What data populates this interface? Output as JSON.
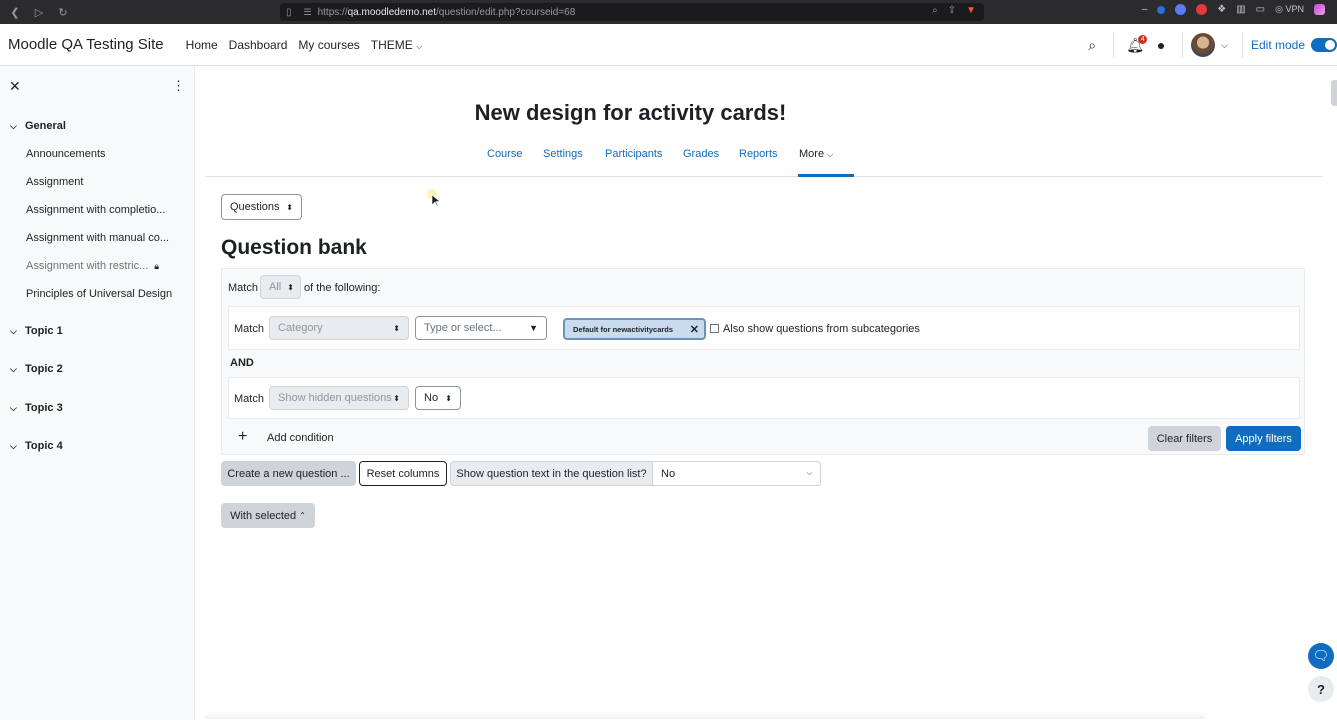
{
  "browser": {
    "url_prefix": "https://",
    "url_host": "qa.moodledemo.net",
    "url_path": "/question/edit.php?courseid=68",
    "vpn_label": "VPN"
  },
  "navbar": {
    "site_name": "Moodle QA Testing Site",
    "nav_items": [
      "Home",
      "Dashboard",
      "My courses",
      "THEME"
    ],
    "notification_count": "4",
    "edit_mode_label": "Edit mode"
  },
  "drawer": {
    "sections": [
      {
        "title": "General",
        "activities": [
          "Announcements",
          "Assignment",
          "Assignment with completio...",
          "Assignment with manual co...",
          "Assignment with restric...",
          "Principles of Universal Design"
        ]
      },
      {
        "title": "Topic 1"
      },
      {
        "title": "Topic 2"
      },
      {
        "title": "Topic 3"
      },
      {
        "title": "Topic 4"
      }
    ]
  },
  "main": {
    "course_title": "New design for activity cards!",
    "secondary_nav": [
      "Course",
      "Settings",
      "Participants",
      "Grades",
      "Reports",
      "More"
    ],
    "questions_select": "Questions",
    "heading": "Question bank",
    "filters": {
      "match_label": "Match",
      "match_value": "All",
      "of_following": "of the following:",
      "row1": {
        "match_label": "Match",
        "type_value": "Category",
        "search_placeholder": "Type or select...",
        "chip_label": "Default for newactivitycards",
        "subcat_label": "Also show questions from subcategories"
      },
      "and_label": "AND",
      "row2": {
        "match_label": "Match",
        "type_value": "Show hidden questions",
        "value": "No"
      },
      "add_condition": "Add condition",
      "clear_filters": "Clear filters",
      "apply_filters": "Apply filters"
    },
    "actions": {
      "create_question": "Create a new question ...",
      "reset_columns": "Reset columns",
      "show_text_label": "Show question text in the question list?",
      "show_text_value": "No",
      "with_selected": "With selected"
    }
  }
}
